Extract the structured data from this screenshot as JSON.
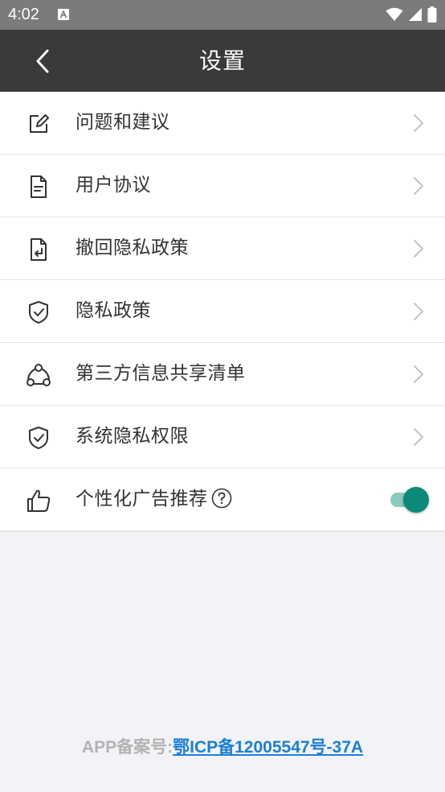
{
  "status_bar": {
    "time": "4:02",
    "notification_icon": "font-a-icon",
    "icons": [
      "wifi-icon",
      "signal-icon",
      "battery-icon"
    ]
  },
  "header": {
    "title": "设置",
    "back_icon": "chevron-left-icon"
  },
  "settings": {
    "items": [
      {
        "label": "问题和建议",
        "icon": "edit-icon"
      },
      {
        "label": "用户协议",
        "icon": "document-icon"
      },
      {
        "label": "撤回隐私政策",
        "icon": "document-return-icon"
      },
      {
        "label": "隐私政策",
        "icon": "shield-check-icon"
      },
      {
        "label": "第三方信息共享清单",
        "icon": "share-network-icon"
      },
      {
        "label": "系统隐私权限",
        "icon": "shield-check-icon"
      }
    ],
    "ad_toggle": {
      "label": "个性化广告推荐",
      "icon": "thumbs-up-icon",
      "help_icon": "question-circle-icon",
      "enabled": true
    }
  },
  "footer": {
    "label": "APP备案号:",
    "link": "鄂ICP备12005547号-37A"
  },
  "colors": {
    "status_bar": "#7b7b7b",
    "app_bar": "#3a3a3c",
    "background": "#f3f3f7",
    "toggle_on": "#0b8a78",
    "toggle_track": "#8ccbc1",
    "link": "#1a7fd8",
    "footer_label": "#b3b3b3"
  }
}
